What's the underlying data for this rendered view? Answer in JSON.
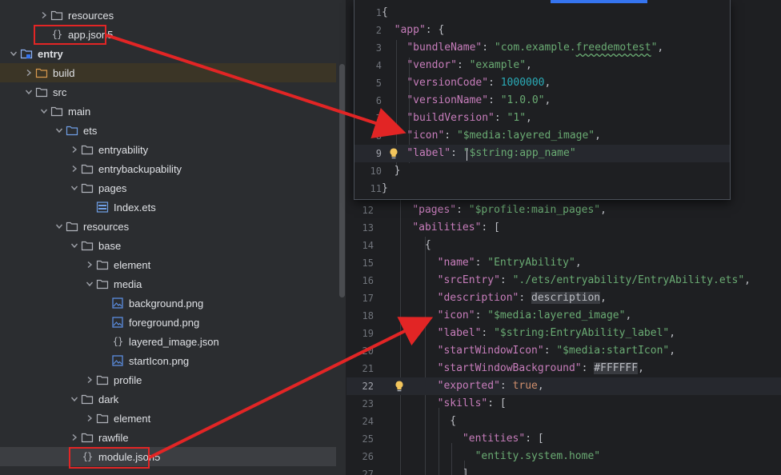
{
  "tree": {
    "items": [
      {
        "label": "resources",
        "type": "folder",
        "expanded": false,
        "depth": 2
      },
      {
        "label": "app.json5",
        "type": "json",
        "depth": 2
      },
      {
        "label": "entry",
        "type": "module",
        "expanded": true,
        "depth": 0,
        "bold": true
      },
      {
        "label": "build",
        "type": "folder-orange",
        "expanded": false,
        "depth": 1
      },
      {
        "label": "src",
        "type": "folder",
        "expanded": true,
        "depth": 1
      },
      {
        "label": "main",
        "type": "folder",
        "expanded": true,
        "depth": 2
      },
      {
        "label": "ets",
        "type": "folder-blue",
        "expanded": true,
        "depth": 3
      },
      {
        "label": "entryability",
        "type": "folder",
        "expanded": false,
        "depth": 4
      },
      {
        "label": "entrybackupability",
        "type": "folder",
        "expanded": false,
        "depth": 4
      },
      {
        "label": "pages",
        "type": "folder",
        "expanded": true,
        "depth": 4
      },
      {
        "label": "Index.ets",
        "type": "ets",
        "depth": 5
      },
      {
        "label": "resources",
        "type": "folder",
        "expanded": true,
        "depth": 3
      },
      {
        "label": "base",
        "type": "folder",
        "expanded": true,
        "depth": 4
      },
      {
        "label": "element",
        "type": "folder",
        "expanded": false,
        "depth": 5
      },
      {
        "label": "media",
        "type": "folder",
        "expanded": true,
        "depth": 5
      },
      {
        "label": "background.png",
        "type": "image",
        "depth": 6
      },
      {
        "label": "foreground.png",
        "type": "image",
        "depth": 6
      },
      {
        "label": "layered_image.json",
        "type": "json",
        "depth": 6
      },
      {
        "label": "startIcon.png",
        "type": "image",
        "depth": 6
      },
      {
        "label": "profile",
        "type": "folder",
        "expanded": false,
        "depth": 5
      },
      {
        "label": "dark",
        "type": "folder",
        "expanded": true,
        "depth": 4
      },
      {
        "label": "element",
        "type": "folder",
        "expanded": false,
        "depth": 5
      },
      {
        "label": "rawfile",
        "type": "folder",
        "expanded": false,
        "depth": 4
      },
      {
        "label": "module.json5",
        "type": "json",
        "depth": 4,
        "selected": true
      }
    ]
  },
  "popup": {
    "lines": [
      {
        "num": "1",
        "text": "{"
      },
      {
        "num": "2",
        "text": "  \"app\": {"
      },
      {
        "num": "3",
        "text": "    \"bundleName\": \"com.example.freedemotest\","
      },
      {
        "num": "4",
        "text": "    \"vendor\": \"example\","
      },
      {
        "num": "5",
        "text": "    \"versionCode\": 1000000,"
      },
      {
        "num": "6",
        "text": "    \"versionName\": \"1.0.0\","
      },
      {
        "num": "7",
        "text": "    \"buildVersion\": \"1\","
      },
      {
        "num": "8",
        "text": "    \"icon\": \"$media:layered_image\","
      },
      {
        "num": "9",
        "text": "    \"label\": \"$string:app_name\""
      },
      {
        "num": "10",
        "text": "  }"
      },
      {
        "num": "11",
        "text": "}"
      }
    ]
  },
  "editor": {
    "lines": [
      {
        "num": "12",
        "text": "    \"pages\": \"$profile:main_pages\","
      },
      {
        "num": "13",
        "text": "    \"abilities\": ["
      },
      {
        "num": "14",
        "text": "      {"
      },
      {
        "num": "15",
        "text": "        \"name\": \"EntryAbility\","
      },
      {
        "num": "16",
        "text": "        \"srcEntry\": \"./ets/entryability/EntryAbility.ets\","
      },
      {
        "num": "17",
        "text": "        \"description\": description,"
      },
      {
        "num": "18",
        "text": "        \"icon\": \"$media:layered_image\","
      },
      {
        "num": "19",
        "text": "        \"label\": \"$string:EntryAbility_label\","
      },
      {
        "num": "20",
        "text": "        \"startWindowIcon\": \"$media:startIcon\","
      },
      {
        "num": "21",
        "text": "        \"startWindowBackground\": #FFFFFF,"
      },
      {
        "num": "22",
        "text": "        \"exported\": true,"
      },
      {
        "num": "23",
        "text": "        \"skills\": ["
      },
      {
        "num": "24",
        "text": "          {"
      },
      {
        "num": "25",
        "text": "            \"entities\": ["
      },
      {
        "num": "26",
        "text": "              \"entity.system.home\""
      },
      {
        "num": "27",
        "text": "            ],"
      }
    ]
  },
  "colors": {
    "annotation": "#e22525",
    "accent": "#3574f0",
    "key": "#c77dbb",
    "string": "#6aab73",
    "number": "#2aacb8",
    "literal": "#cf8e6d"
  }
}
